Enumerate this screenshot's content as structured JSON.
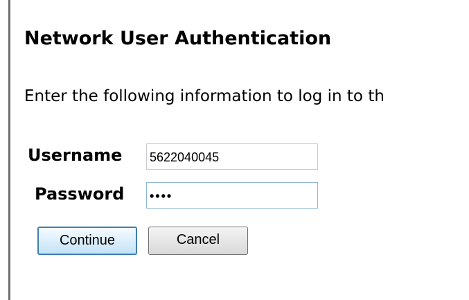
{
  "auth": {
    "title": "Network User Authentication",
    "instructions": "Enter the following information to log in to th",
    "username_label": "Username",
    "username_value": "5622040045",
    "password_label": "Password",
    "password_mask": "••••",
    "continue_label": "Continue",
    "cancel_label": "Cancel"
  },
  "colors": {
    "background": "#ffffff",
    "left_rule": "#6f6f6f",
    "focus_border": "#8fb6d8",
    "default_button_border": "#3c7fb1"
  }
}
